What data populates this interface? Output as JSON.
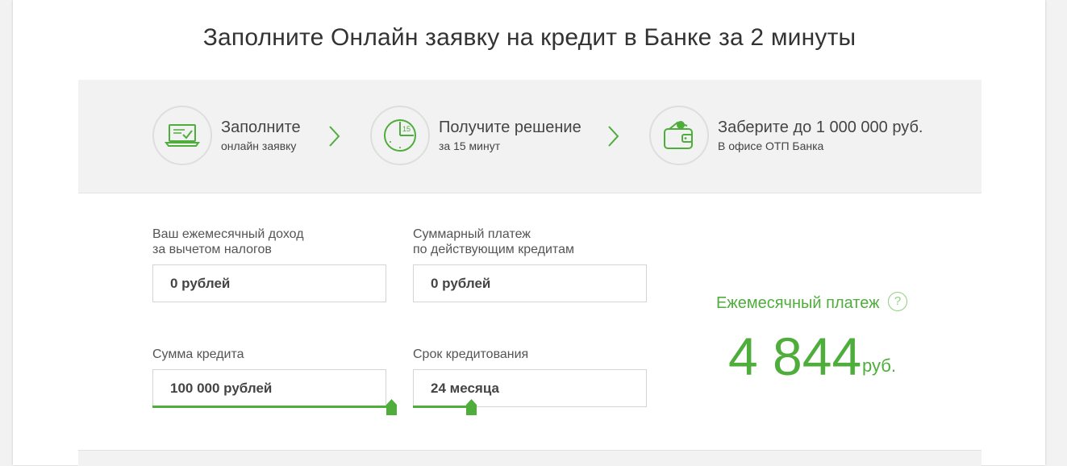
{
  "page": {
    "title": "Заполните Онлайн заявку на кредит в Банке за 2 минуты"
  },
  "steps": [
    {
      "title": "Заполните",
      "subtitle": "онлайн заявку",
      "icon": "laptop-check-icon"
    },
    {
      "title": "Получите решение",
      "subtitle": "за 15 минут",
      "icon": "clock-15-icon"
    },
    {
      "title": "Заберите до 1 000 000 руб.",
      "subtitle": "В офисе ОТП Банка",
      "icon": "wallet-money-icon"
    }
  ],
  "form": {
    "income": {
      "label_line1": "Ваш ежемесячный доход",
      "label_line2": "за вычетом налогов",
      "value": "0 рублей"
    },
    "payments": {
      "label_line1": "Суммарный платеж",
      "label_line2": "по действующим кредитам",
      "value": "0 рублей"
    },
    "amount": {
      "label": "Сумма кредита",
      "value": "100 000 рублей",
      "slider_fraction": 1.0
    },
    "term": {
      "label": "Срок кредитования",
      "value": "24 месяца",
      "slider_fraction": 0.25
    }
  },
  "result": {
    "label": "Ежемесячный платеж",
    "help": "?",
    "value": "4 844",
    "unit": "руб."
  },
  "colors": {
    "accent": "#4fad3b",
    "background": "#f2f2f2"
  }
}
